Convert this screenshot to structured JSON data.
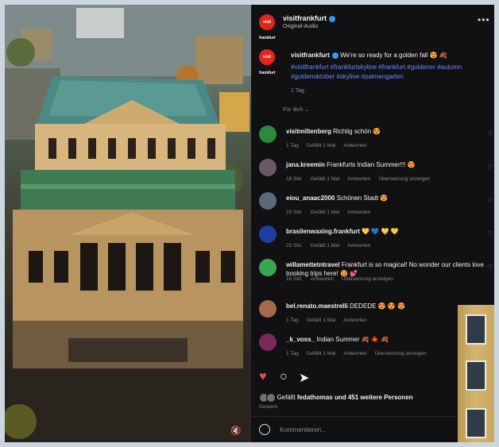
{
  "post": {
    "account": "visitfrankfurt",
    "avatar_text": "visit frankfurt",
    "audio": "Original-Audio",
    "caption_text": "We're so ready for a golden fall 😍 🍂",
    "hashtags": "#visitfrankfurt #frankfurtskyline #frankfurt #goldener #autumn #goldenoktober #skyline #palmengarten",
    "caption_time": "1 Tag",
    "for_you": "Für dich ⌄"
  },
  "comments": [
    {
      "user": "visitmiltenberg",
      "text": "Richtig schön 😍",
      "meta": [
        "1 Tag",
        "Gefällt 2 Mal",
        "Antworten"
      ],
      "color": "#2b8a3e"
    },
    {
      "user": "jana.kreemin",
      "text": "Frankfurts Indian Summer!!! 😍",
      "meta": [
        "18 Std.",
        "Gefällt 1 Mal",
        "Antworten",
        "Übersetzung anzeigen"
      ],
      "color": "#6b5a66"
    },
    {
      "user": "eiou_anaac2000",
      "text": "Schönen Stadt 😍",
      "meta": [
        "23 Std.",
        "Gefällt 1 Mal",
        "Antworten"
      ],
      "color": "#5a6a7b"
    },
    {
      "user": "brasilenwaxing.frankfurt",
      "text": "💛 💙 💛 💛",
      "meta": [
        "20 Std.",
        "Gefällt 1 Mal",
        "Antworten"
      ],
      "color": "#1c3fa0"
    },
    {
      "user": "willamettetntravel",
      "text": "Frankfurt is so magical! No wonder our clients love booking trips here! 🤩 💕",
      "meta": [
        "16 Std.",
        "Antworten",
        "Übersetzung anzeigen"
      ],
      "color": "#3aa651"
    },
    {
      "user": "bel.renato.maestrelli",
      "text": "DEDEDE 😍 😍 😍",
      "meta": [
        "1 Tag",
        "Gefällt 1 Mal",
        "Antworten"
      ],
      "color": "#a46a4a"
    },
    {
      "user": "_k_voss_",
      "text": "Indian Summer 🍂 🍁 🍂",
      "meta": [
        "1 Tag",
        "Gefällt 1 Mal",
        "Antworten",
        "Übersetzung anzeigen"
      ],
      "color": "#7a2a5a"
    }
  ],
  "likes": {
    "prefix": "Gefällt",
    "user": "fedathomas",
    "suffix": "und 451 weitere Personen"
  },
  "date": "Gestern",
  "compose": {
    "placeholder": "Kommentieren..."
  },
  "icons": {
    "heart": "heart-icon",
    "comment": "comment-icon",
    "share": "share-icon",
    "mute": "mute-icon",
    "more": "more-icon",
    "emoji": "emoji-icon"
  },
  "colors": {
    "panel": "#111113",
    "like": "#ed4956",
    "hashtag": "#6a8bff",
    "brand": "#e1251b"
  }
}
